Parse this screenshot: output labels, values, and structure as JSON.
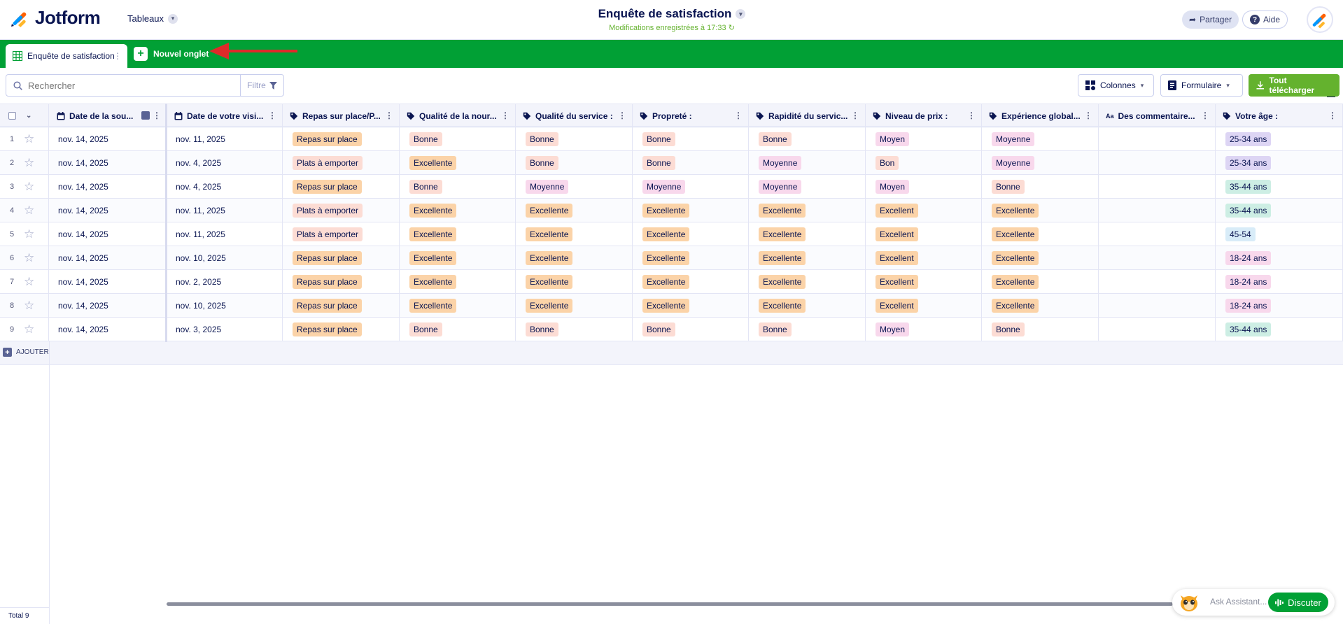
{
  "header": {
    "logo_text": "Jotform",
    "tables_label": "Tableaux",
    "doc_title": "Enquête de satisfaction",
    "saved_status": "Modifications enregistrées à 17:33",
    "share_label": "Partager",
    "help_label": "Aide"
  },
  "tabs": {
    "active_label": "Enquête de satisfaction",
    "new_tab_label": "Nouvel onglet"
  },
  "toolbar": {
    "search_placeholder": "Rechercher",
    "filter_label": "Filtre",
    "columns_label": "Colonnes",
    "form_label": "Formulaire",
    "download_label": "Tout télécharger"
  },
  "columns": [
    {
      "label": "Date de la sou...",
      "icon": "calendar-icon"
    },
    {
      "label": "Date de votre visi...",
      "icon": "calendar-icon"
    },
    {
      "label": "Repas sur place/P...",
      "icon": "tag-icon"
    },
    {
      "label": "Qualité de la nour...",
      "icon": "tag-icon"
    },
    {
      "label": "Qualité du service :",
      "icon": "tag-icon"
    },
    {
      "label": "Propreté :",
      "icon": "tag-icon"
    },
    {
      "label": "Rapidité du servic...",
      "icon": "tag-icon"
    },
    {
      "label": "Niveau de prix :",
      "icon": "tag-icon"
    },
    {
      "label": "Expérience global...",
      "icon": "tag-icon"
    },
    {
      "label": "Des commentaire...",
      "icon": "text-icon"
    },
    {
      "label": "Votre âge :",
      "icon": "tag-icon"
    }
  ],
  "rows": [
    {
      "n": "1",
      "c": [
        "nov. 14, 2025",
        "nov. 11, 2025",
        "Repas sur place",
        "Bonne",
        "Bonne",
        "Bonne",
        "Bonne",
        "Moyen",
        "Moyenne",
        "",
        "25-34 ans"
      ]
    },
    {
      "n": "2",
      "c": [
        "nov. 14, 2025",
        "nov. 4, 2025",
        "Plats à emporter",
        "Excellente",
        "Bonne",
        "Bonne",
        "Moyenne",
        "Bon",
        "Moyenne",
        "",
        "25-34 ans"
      ]
    },
    {
      "n": "3",
      "c": [
        "nov. 14, 2025",
        "nov. 4, 2025",
        "Repas sur place",
        "Bonne",
        "Moyenne",
        "Moyenne",
        "Moyenne",
        "Moyen",
        "Bonne",
        "",
        "35-44 ans"
      ]
    },
    {
      "n": "4",
      "c": [
        "nov. 14, 2025",
        "nov. 11, 2025",
        "Plats à emporter",
        "Excellente",
        "Excellente",
        "Excellente",
        "Excellente",
        "Excellent",
        "Excellente",
        "",
        "35-44 ans"
      ]
    },
    {
      "n": "5",
      "c": [
        "nov. 14, 2025",
        "nov. 11, 2025",
        "Plats à emporter",
        "Excellente",
        "Excellente",
        "Excellente",
        "Excellente",
        "Excellent",
        "Excellente",
        "",
        "45-54"
      ]
    },
    {
      "n": "6",
      "c": [
        "nov. 14, 2025",
        "nov. 10, 2025",
        "Repas sur place",
        "Excellente",
        "Excellente",
        "Excellente",
        "Excellente",
        "Excellent",
        "Excellente",
        "",
        "18-24 ans"
      ]
    },
    {
      "n": "7",
      "c": [
        "nov. 14, 2025",
        "nov. 2, 2025",
        "Repas sur place",
        "Excellente",
        "Excellente",
        "Excellente",
        "Excellente",
        "Excellent",
        "Excellente",
        "",
        "18-24 ans"
      ]
    },
    {
      "n": "8",
      "c": [
        "nov. 14, 2025",
        "nov. 10, 2025",
        "Repas sur place",
        "Excellente",
        "Excellente",
        "Excellente",
        "Excellente",
        "Excellent",
        "Excellente",
        "",
        "18-24 ans"
      ]
    },
    {
      "n": "9",
      "c": [
        "nov. 14, 2025",
        "nov. 3, 2025",
        "Repas sur place",
        "Bonne",
        "Bonne",
        "Bonne",
        "Bonne",
        "Moyen",
        "Bonne",
        "",
        "35-44 ans"
      ]
    }
  ],
  "tag_colors": {
    "Repas sur place": "#fbd3a8",
    "Plats à emporter": "#fcdcd4",
    "Bonne": "#fcdcd4",
    "Excellente": "#fbd3a8",
    "Moyenne": "#f8d8ec",
    "Moyen": "#f8d8ec",
    "Bon": "#fcdcd4",
    "Excellent": "#fbd3a8",
    "25-34 ans": "#ddd5f4",
    "35-44 ans": "#cdeee4",
    "45-54": "#d8ecf8",
    "18-24 ans": "#f8d8ec"
  },
  "footer": {
    "add_label": "AJOUTER",
    "total_label": "Total 9",
    "ask_placeholder": "Ask Assistant...",
    "chat_label": "Discuter"
  },
  "colors": {
    "brand_green": "#01a035",
    "download_green": "#64b22e",
    "navy": "#0a1551"
  }
}
